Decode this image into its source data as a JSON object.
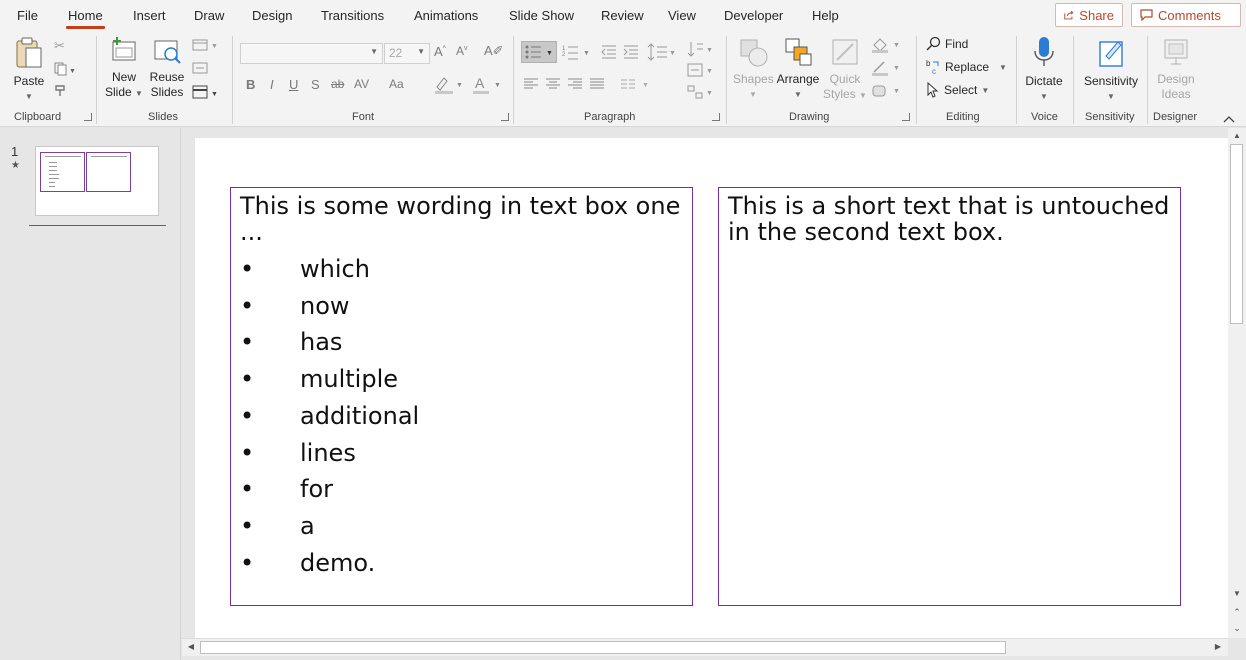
{
  "menu": {
    "tabs": [
      "File",
      "Home",
      "Insert",
      "Draw",
      "Design",
      "Transitions",
      "Animations",
      "Slide Show",
      "Review",
      "View",
      "Developer",
      "Help"
    ],
    "active_tab": "Home",
    "share_label": "Share",
    "comments_label": "Comments"
  },
  "ribbon": {
    "clipboard": {
      "paste": "Paste",
      "group_label": "Clipboard"
    },
    "slides": {
      "new_slide_1": "New",
      "new_slide_2": "Slide",
      "reuse_1": "Reuse",
      "reuse_2": "Slides",
      "group_label": "Slides"
    },
    "font": {
      "font_size": "22",
      "group_label": "Font",
      "bold": "B",
      "italic": "I",
      "underline": "U",
      "shadow": "S",
      "strike": "ab",
      "spacing": "AV",
      "case": "Aa"
    },
    "paragraph": {
      "group_label": "Paragraph"
    },
    "drawing": {
      "shapes_1": "Shapes",
      "arrange": "Arrange",
      "quick_1": "Quick",
      "quick_2": "Styles",
      "group_label": "Drawing"
    },
    "editing": {
      "find": "Find",
      "replace": "Replace",
      "select": "Select",
      "group_label": "Editing"
    },
    "voice": {
      "dictate": "Dictate",
      "group_label": "Voice"
    },
    "sensitivity": {
      "sensitivity": "Sensitivity",
      "group_label": "Sensitivity"
    },
    "designer": {
      "design_1": "Design",
      "design_2": "Ideas",
      "group_label": "Designer"
    }
  },
  "thumbnails": {
    "slide_number": "1",
    "star": "★"
  },
  "slide": {
    "box1": {
      "title": "This is some wording in text box one ...",
      "bullets": [
        "which",
        "now",
        "has",
        "multiple",
        "additional",
        "lines",
        "for",
        "a",
        "demo."
      ]
    },
    "box2": {
      "text": "This is a short text that is untouched in the second text box."
    }
  },
  "colors": {
    "accent": "#c43e1c",
    "textbox_border": "#7030a0",
    "ribbon_bg": "#f3f3f3"
  }
}
